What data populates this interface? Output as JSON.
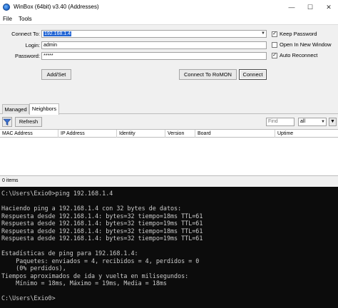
{
  "window": {
    "title": "WinBox (64bit) v3.40 (Addresses)",
    "minimize_glyph": "—",
    "maximize_glyph": "☐",
    "close_glyph": "✕"
  },
  "menu": {
    "file": "File",
    "tools": "Tools"
  },
  "connect": {
    "connect_to_label": "Connect To:",
    "connect_to_value": "192.168.1.4",
    "login_label": "Login:",
    "login_value": "admin",
    "password_label": "Password:",
    "password_value": "*****",
    "keep_password": "Keep Password",
    "open_new_window": "Open In New Window",
    "auto_reconnect": "Auto Reconnect",
    "keep_password_checked": true,
    "open_new_window_checked": false,
    "auto_reconnect_checked": true,
    "add_set_label": "Add/Set",
    "connect_romon_label": "Connect To RoMON",
    "connect_label": "Connect"
  },
  "tabs": {
    "managed": "Managed",
    "neighbors": "Neighbors"
  },
  "toolbar": {
    "refresh_label": "Refresh",
    "find_placeholder": "Find",
    "filter_value": "all",
    "more_glyph": "▼"
  },
  "table": {
    "columns": [
      "MAC Address",
      "IP Address",
      "Identity",
      "Version",
      "Board",
      "Uptime"
    ]
  },
  "status": {
    "items": "0 items"
  },
  "console": {
    "lines": [
      "C:\\Users\\Exio0>ping 192.168.1.4",
      "",
      "Haciendo ping a 192.168.1.4 con 32 bytes de datos:",
      "Respuesta desde 192.168.1.4: bytes=32 tiempo=18ms TTL=61",
      "Respuesta desde 192.168.1.4: bytes=32 tiempo=19ms TTL=61",
      "Respuesta desde 192.168.1.4: bytes=32 tiempo=18ms TTL=61",
      "Respuesta desde 192.168.1.4: bytes=32 tiempo=19ms TTL=61",
      "",
      "Estadísticas de ping para 192.168.1.4:",
      "    Paquetes: enviados = 4, recibidos = 4, perdidos = 0",
      "    (0% perdidos),",
      "Tiempos aproximados de ida y vuelta en milisegundos:",
      "    Mínimo = 18ms, Máximo = 19ms, Media = 18ms",
      "",
      "C:\\Users\\Exio0>"
    ]
  }
}
